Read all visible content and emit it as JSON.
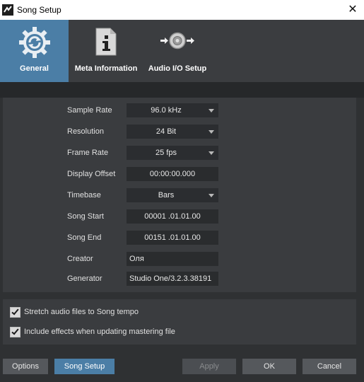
{
  "window": {
    "title": "Song Setup",
    "app_icon": "studio-one-icon",
    "close_glyph": "✕"
  },
  "tabs": [
    {
      "label": "General",
      "icon": "gear-icon",
      "active": true
    },
    {
      "label": "Meta Information",
      "icon": "document-info-icon",
      "active": false
    },
    {
      "label": "Audio I/O Setup",
      "icon": "speaker-io-icon",
      "active": false
    }
  ],
  "form": {
    "sample_rate": {
      "label": "Sample Rate",
      "value": "96.0 kHz"
    },
    "resolution": {
      "label": "Resolution",
      "value": "24 Bit"
    },
    "frame_rate": {
      "label": "Frame Rate",
      "value": "25 fps"
    },
    "display_offset": {
      "label": "Display Offset",
      "value": "00:00:00.000"
    },
    "timebase": {
      "label": "Timebase",
      "value": "Bars"
    },
    "song_start": {
      "label": "Song Start",
      "value": "00001 .01.01.00"
    },
    "song_end": {
      "label": "Song End",
      "value": "00151 .01.01.00"
    },
    "creator": {
      "label": "Creator",
      "value": "Оля"
    },
    "generator": {
      "label": "Generator",
      "value": "Studio One/3.2.3.38191"
    }
  },
  "options": {
    "stretch_audio": {
      "label": "Stretch audio files to Song tempo",
      "checked": true
    },
    "include_effects": {
      "label": "Include effects when updating mastering file",
      "checked": true
    }
  },
  "buttons": {
    "options": "Options",
    "song_setup": "Song Setup",
    "apply": "Apply",
    "ok": "OK",
    "cancel": "Cancel"
  },
  "colors": {
    "accent": "#4b7ea6",
    "background": "#2f3133",
    "panel": "#3a3c3f"
  }
}
